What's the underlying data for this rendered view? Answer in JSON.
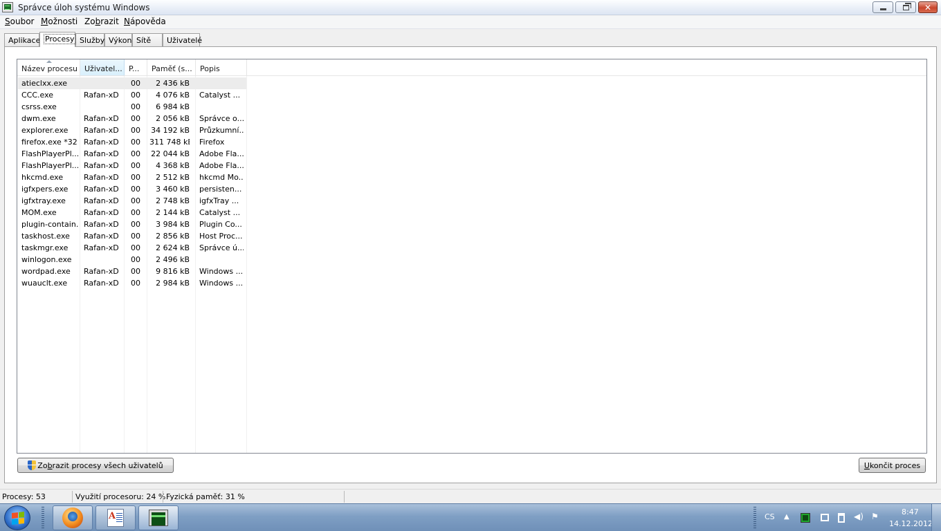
{
  "window": {
    "title": "Správce úloh systému Windows"
  },
  "menu": [
    {
      "pre": "",
      "u": "S",
      "post": "oubor"
    },
    {
      "pre": "",
      "u": "M",
      "post": "ožnosti"
    },
    {
      "pre": "Zo",
      "u": "b",
      "post": "razit"
    },
    {
      "pre": "",
      "u": "N",
      "post": "ápověda"
    }
  ],
  "tabs": [
    "Aplikace",
    "Procesy",
    "Služby",
    "Výkon",
    "Sítě",
    "Uživatelé"
  ],
  "active_tab": "Procesy",
  "columns": [
    "Název procesu",
    "Uživatel...",
    "P...",
    "Paměť (s...",
    "Popis"
  ],
  "sorted_column": "Uživatel...",
  "processes": [
    {
      "name": "atieclxx.exe",
      "user": "",
      "cpu": "00",
      "mem": "2 436 kB",
      "desc": "",
      "selected": true
    },
    {
      "name": "CCC.exe",
      "user": "Rafan-xD",
      "cpu": "00",
      "mem": "4 076 kB",
      "desc": "Catalyst ..."
    },
    {
      "name": "csrss.exe",
      "user": "",
      "cpu": "00",
      "mem": "6 984 kB",
      "desc": ""
    },
    {
      "name": "dwm.exe",
      "user": "Rafan-xD",
      "cpu": "00",
      "mem": "2 056 kB",
      "desc": "Správce o..."
    },
    {
      "name": "explorer.exe",
      "user": "Rafan-xD",
      "cpu": "00",
      "mem": "34 192 kB",
      "desc": "Průzkumní..."
    },
    {
      "name": "firefox.exe *32",
      "user": "Rafan-xD",
      "cpu": "00",
      "mem": "311 748 kB",
      "desc": "Firefox"
    },
    {
      "name": "FlashPlayerPl...",
      "user": "Rafan-xD",
      "cpu": "00",
      "mem": "22 044 kB",
      "desc": "Adobe Fla..."
    },
    {
      "name": "FlashPlayerPl...",
      "user": "Rafan-xD",
      "cpu": "00",
      "mem": "4 368 kB",
      "desc": "Adobe Fla..."
    },
    {
      "name": "hkcmd.exe",
      "user": "Rafan-xD",
      "cpu": "00",
      "mem": "2 512 kB",
      "desc": "hkcmd Mo..."
    },
    {
      "name": "igfxpers.exe",
      "user": "Rafan-xD",
      "cpu": "00",
      "mem": "3 460 kB",
      "desc": "persisten..."
    },
    {
      "name": "igfxtray.exe",
      "user": "Rafan-xD",
      "cpu": "00",
      "mem": "2 748 kB",
      "desc": "igfxTray ..."
    },
    {
      "name": "MOM.exe",
      "user": "Rafan-xD",
      "cpu": "00",
      "mem": "2 144 kB",
      "desc": "Catalyst ..."
    },
    {
      "name": "plugin-contain...",
      "user": "Rafan-xD",
      "cpu": "00",
      "mem": "3 984 kB",
      "desc": "Plugin Co..."
    },
    {
      "name": "taskhost.exe",
      "user": "Rafan-xD",
      "cpu": "00",
      "mem": "2 856 kB",
      "desc": "Host Proc..."
    },
    {
      "name": "taskmgr.exe",
      "user": "Rafan-xD",
      "cpu": "00",
      "mem": "2 624 kB",
      "desc": "Správce ú..."
    },
    {
      "name": "winlogon.exe",
      "user": "",
      "cpu": "00",
      "mem": "2 496 kB",
      "desc": ""
    },
    {
      "name": "wordpad.exe",
      "user": "Rafan-xD",
      "cpu": "00",
      "mem": "9 816 kB",
      "desc": "Windows ..."
    },
    {
      "name": "wuauclt.exe",
      "user": "Rafan-xD",
      "cpu": "00",
      "mem": "2 984 kB",
      "desc": "Windows ..."
    }
  ],
  "buttons": {
    "show_all_pre": "Zo",
    "show_all_u": "b",
    "show_all_post": "razit procesy všech uživatelů",
    "end_process_pre": "",
    "end_process_u": "U",
    "end_process_post": "končit proces"
  },
  "status": {
    "processes": "Procesy: 53",
    "cpu": "Využití procesoru: 24 %",
    "memory": "Fyzická paměť: 31 %"
  },
  "taskbar": {
    "apps": [
      "firefox-icon",
      "wordpad-icon",
      "task-manager-icon"
    ],
    "language": "CS",
    "time": "8:47",
    "date": "14.12.2012"
  }
}
